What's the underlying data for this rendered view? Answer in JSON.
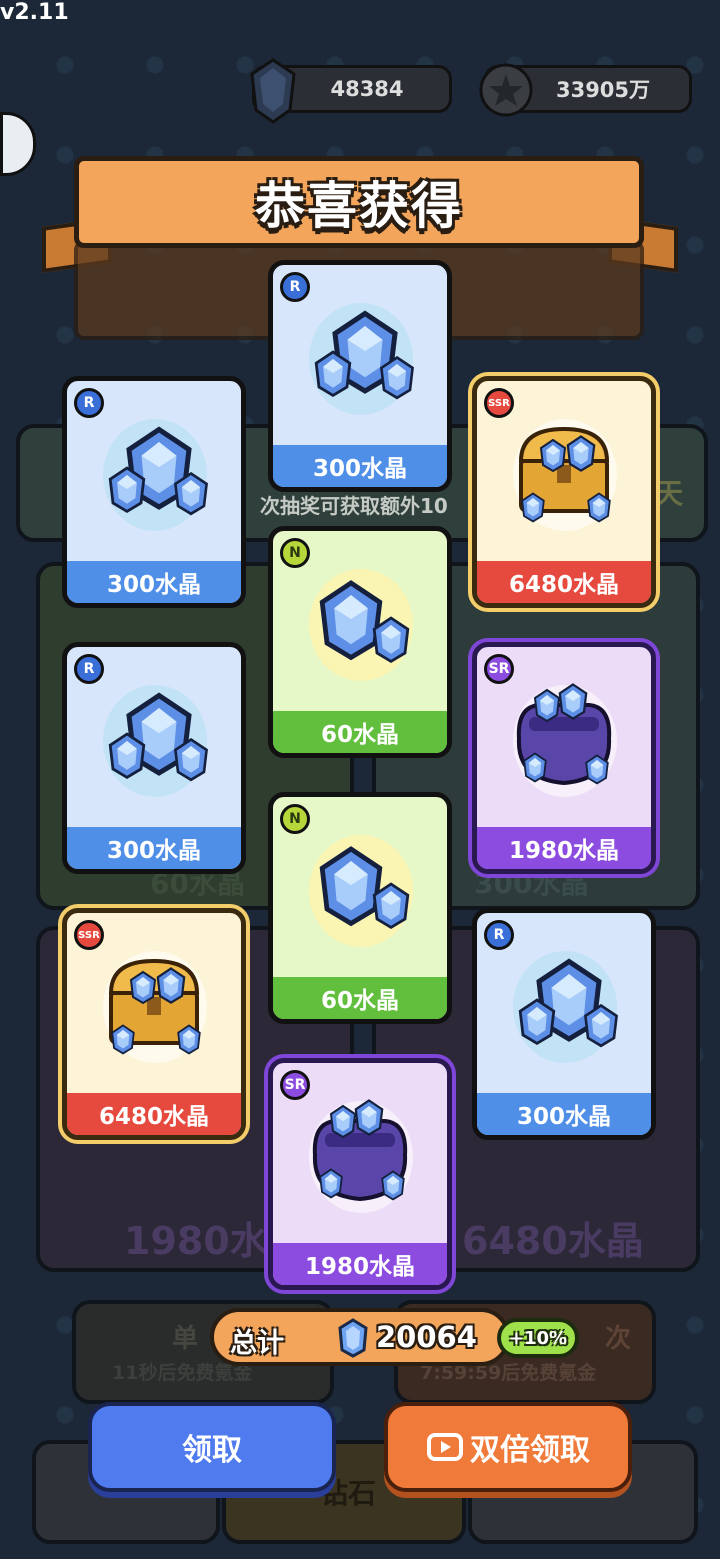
{
  "version": "v2.11",
  "currency": {
    "crystal_amount": "48384",
    "coin_amount": "33905万"
  },
  "banner": {
    "title": "恭喜获得"
  },
  "background": {
    "subtitle_partial": "次抽奖可获取额外10",
    "price_left": "60水晶",
    "price_right": "300水晶",
    "big_left": "1980水晶",
    "big_right": "6480水晶",
    "free_left": "11秒后免费氪金",
    "free_right": "7:59:59后免费氪金",
    "single_partial": "单",
    "multi_partial": "次",
    "bottom_mid": "钻石",
    "day_partial": "天"
  },
  "cards": [
    {
      "rarity": "R",
      "label": "300水晶"
    },
    {
      "rarity": "R",
      "label": "300水晶"
    },
    {
      "rarity": "SSR",
      "label": "6480水晶"
    },
    {
      "rarity": "N",
      "label": "60水晶"
    },
    {
      "rarity": "R",
      "label": "300水晶"
    },
    {
      "rarity": "SR",
      "label": "1980水晶"
    },
    {
      "rarity": "N",
      "label": "60水晶"
    },
    {
      "rarity": "SSR",
      "label": "6480水晶"
    },
    {
      "rarity": "R",
      "label": "300水晶"
    },
    {
      "rarity": "SR",
      "label": "1980水晶"
    }
  ],
  "total": {
    "label": "总计",
    "value": "20064",
    "bonus": "+10%"
  },
  "buttons": {
    "claim": "领取",
    "double_claim": "双倍领取"
  },
  "colors": {
    "background": "#1c2838",
    "banner": "#f3a65b",
    "claim_button": "#4f7bef",
    "double_button": "#ef7a3a",
    "R": "#4f8fe8",
    "N": "#62bf3e",
    "SR": "#8c4ce0",
    "SSR": "#e64a3f"
  }
}
